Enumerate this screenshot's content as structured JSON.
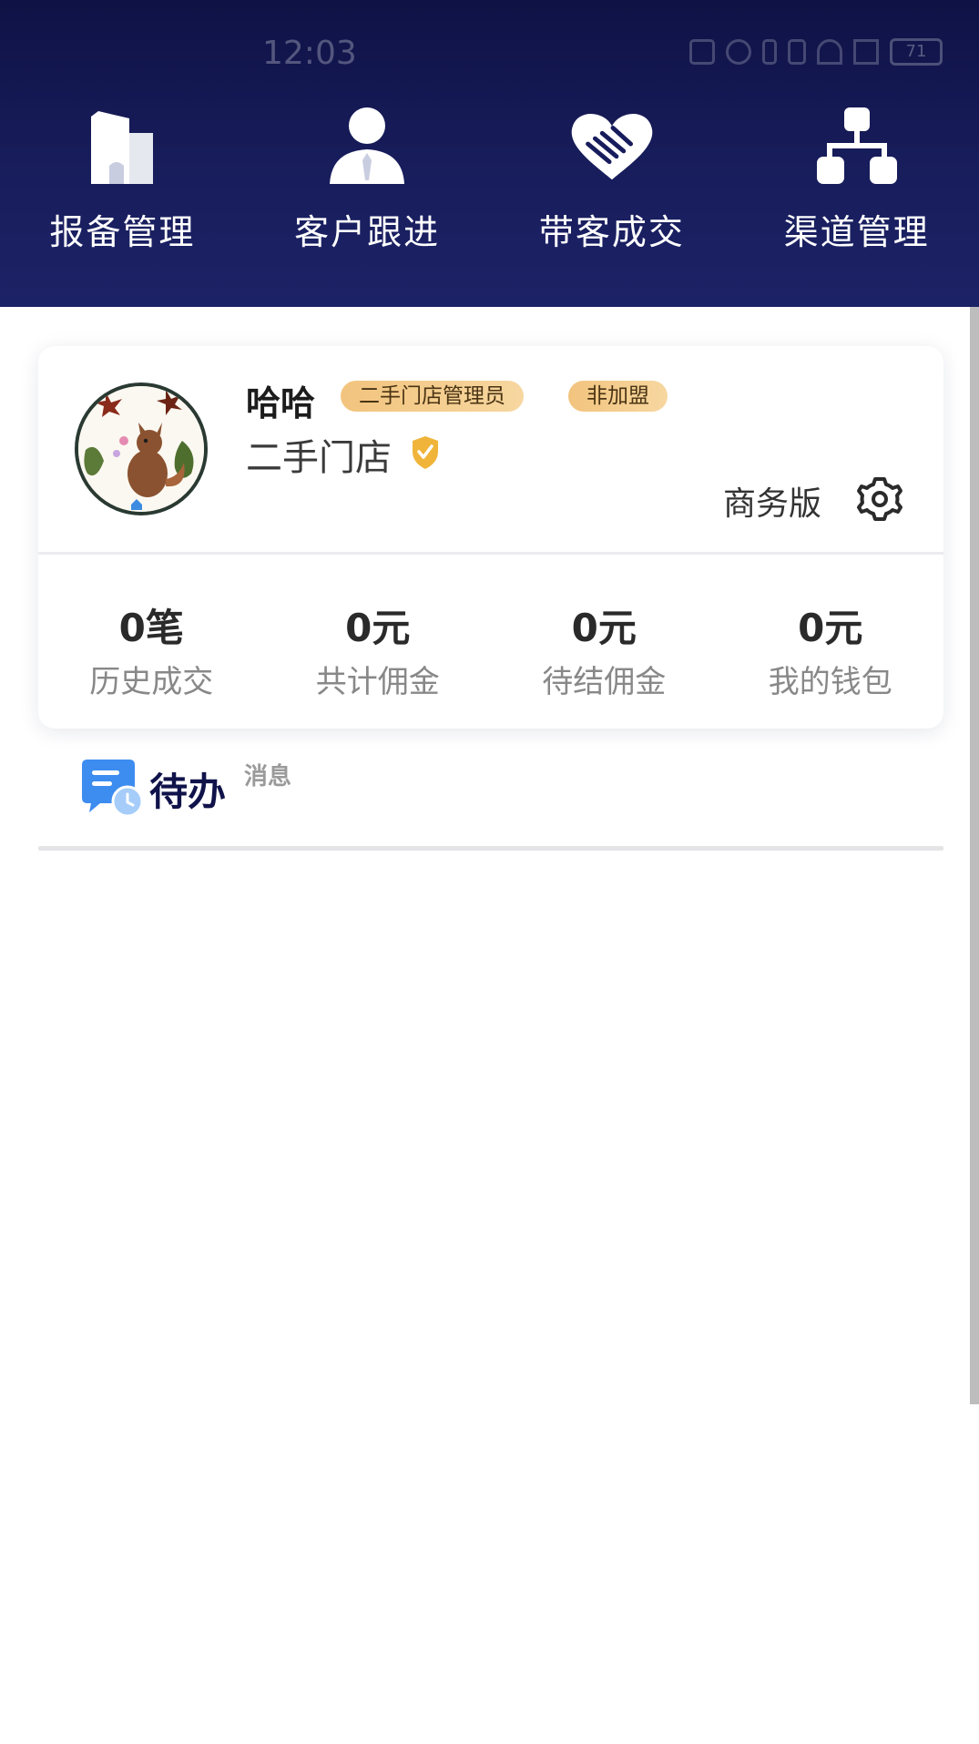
{
  "status_bar": {
    "time": "12:03",
    "battery": "71",
    "icons": [
      "nfc-icon",
      "alarm-icon",
      "bluetooth-icon",
      "vibrate-icon",
      "wifi-icon",
      "signal-icon",
      "battery-icon"
    ]
  },
  "nav": {
    "items": [
      {
        "label": "报备管理",
        "icon": "building-icon"
      },
      {
        "label": "客户跟进",
        "icon": "person-icon"
      },
      {
        "label": "带客成交",
        "icon": "heart-handshake-icon"
      },
      {
        "label": "渠道管理",
        "icon": "org-chart-icon"
      }
    ]
  },
  "profile": {
    "name": "哈哈",
    "role_badge": "二手门店管理员",
    "type_badge": "非加盟",
    "store": "二手门店",
    "edition": "商务版"
  },
  "stats": [
    {
      "value": "0笔",
      "label": "历史成交"
    },
    {
      "value": "0元",
      "label": "共计佣金"
    },
    {
      "value": "0元",
      "label": "待结佣金"
    },
    {
      "value": "0元",
      "label": "我的钱包"
    }
  ],
  "tabs": {
    "todo": "待办",
    "messages": "消息"
  },
  "colors": {
    "header_bg": "#141850",
    "badge_gold": "#f2c47e",
    "todo_title": "#10134a"
  }
}
